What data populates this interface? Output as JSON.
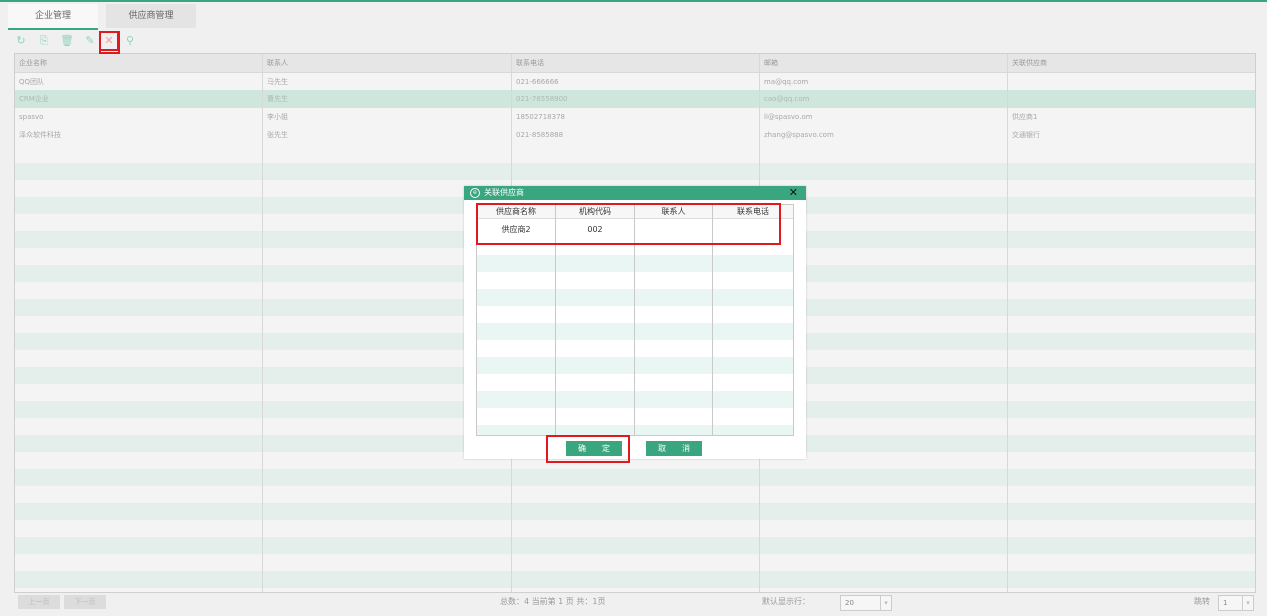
{
  "tabs": [
    {
      "label": "企业管理",
      "active": true
    },
    {
      "label": "供应商管理",
      "active": false
    }
  ],
  "toolbar": {
    "refresh_icon": "↻",
    "export_icon": "⎘",
    "delete_icon": "🗑",
    "edit_icon": "✎",
    "link_icon": "✕",
    "unlink_icon": "⚲"
  },
  "grid": {
    "headers": [
      "企业名称",
      "联系人",
      "联系电话",
      "邮箱",
      "关联供应商"
    ],
    "rows": [
      [
        "QQ团队",
        "马先生",
        "021-666666",
        "ma@qq.com",
        ""
      ],
      [
        "CRM企业",
        "曹先生",
        "021-76558900",
        "cao@qq.com",
        ""
      ],
      [
        "spasvo",
        "李小姐",
        "18502718378",
        "li@spasvo.om",
        "供应商1"
      ],
      [
        "泽众软件科技",
        "张先生",
        "021-8585888",
        "zhang@spasvo.com",
        "交通银行"
      ]
    ],
    "selected_row": 1
  },
  "pager": {
    "prev": "上一页",
    "next": "下一页",
    "summary": "总数：4   当前第 1 页    共：1页",
    "rows_label": "默认显示行：",
    "rows_value": "20",
    "jump_label": "跳转",
    "jump_value": "1"
  },
  "dialog": {
    "title": "关联供应商",
    "close": "✕",
    "headers": [
      "供应商名称",
      "机构代码",
      "联系人",
      "联系电话"
    ],
    "rows": [
      [
        "供应商2",
        "002",
        "",
        ""
      ]
    ],
    "confirm": "确　　定",
    "cancel": "取　　消"
  },
  "colors": {
    "accent": "#3aa680",
    "highlight": "#e0191f",
    "selected_row": "#cfe6dc"
  }
}
